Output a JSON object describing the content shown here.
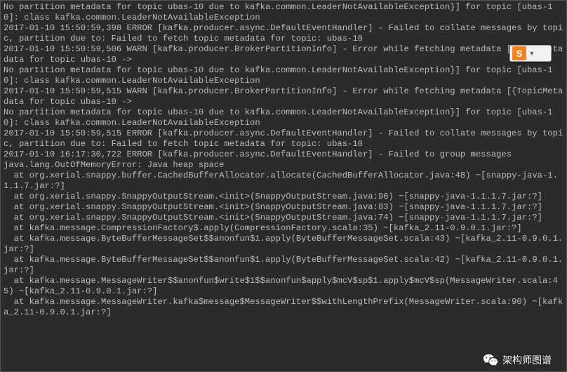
{
  "terminal": {
    "lines": [
      "No partition metadata for topic ubas-10 due to kafka.common.LeaderNotAvailableException}] for topic [ubas-10]: class kafka.common.LeaderNotAvailableException",
      "2017-01-10 15:50:59,398 ERROR [kafka.producer.async.DefaultEventHandler] - Failed to collate messages by topic, partition due to: Failed to fetch topic metadata for topic: ubas-10",
      "2017-01-10 15:50:59,506 WARN [kafka.producer.BrokerPartitionInfo] - Error while fetching metadata [{TopicMetadata for topic ubas-10 ->",
      "No partition metadata for topic ubas-10 due to kafka.common.LeaderNotAvailableException}] for topic [ubas-10]: class kafka.common.LeaderNotAvailableException",
      "2017-01-10 15:50:59,515 WARN [kafka.producer.BrokerPartitionInfo] - Error while fetching metadata [{TopicMetadata for topic ubas-10 ->",
      "No partition metadata for topic ubas-10 due to kafka.common.LeaderNotAvailableException}] for topic [ubas-10]: class kafka.common.LeaderNotAvailableException",
      "2017-01-10 15:50:59,515 ERROR [kafka.producer.async.DefaultEventHandler] - Failed to collate messages by topic, partition due to: Failed to fetch topic metadata for topic: ubas-10",
      "2017-01-10 16:17:30,722 ERROR [kafka.producer.async.DefaultEventHandler] - Failed to group messages",
      "java.lang.OutOfMemoryError: Java heap space",
      "  at org.xerial.snappy.buffer.CachedBufferAllocator.allocate(CachedBufferAllocator.java:48) ~[snappy-java-1.1.1.7.jar:?]",
      "  at org.xerial.snappy.SnappyOutputStream.<init>(SnappyOutputStream.java:96) ~[snappy-java-1.1.1.7.jar:?]",
      "  at org.xerial.snappy.SnappyOutputStream.<init>(SnappyOutputStream.java:83) ~[snappy-java-1.1.1.7.jar:?]",
      "  at org.xerial.snappy.SnappyOutputStream.<init>(SnappyOutputStream.java:74) ~[snappy-java-1.1.1.7.jar:?]",
      "  at kafka.message.CompressionFactory$.apply(CompressionFactory.scala:35) ~[kafka_2.11-0.9.0.1.jar:?]",
      "  at kafka.message.ByteBufferMessageSet$$anonfun$1.apply(ByteBufferMessageSet.scala:43) ~[kafka_2.11-0.9.0.1.jar:?]",
      "  at kafka.message.ByteBufferMessageSet$$anonfun$1.apply(ByteBufferMessageSet.scala:42) ~[kafka_2.11-0.9.0.1.jar:?]",
      "  at kafka.message.MessageWriter$$anonfun$write$1$$anonfun$apply$mcV$sp$1.apply$mcV$sp(MessageWriter.scala:45) ~[kafka_2.11-0.9.0.1.jar:?]",
      "  at kafka.message.MessageWriter.kafka$message$MessageWriter$$withLengthPrefix(MessageWriter.scala:90) ~[kafka_2.11-0.9.0.1.jar:?]"
    ]
  },
  "ime_badge": {
    "letter": "S"
  },
  "footer": {
    "text": "架构师图谱"
  }
}
